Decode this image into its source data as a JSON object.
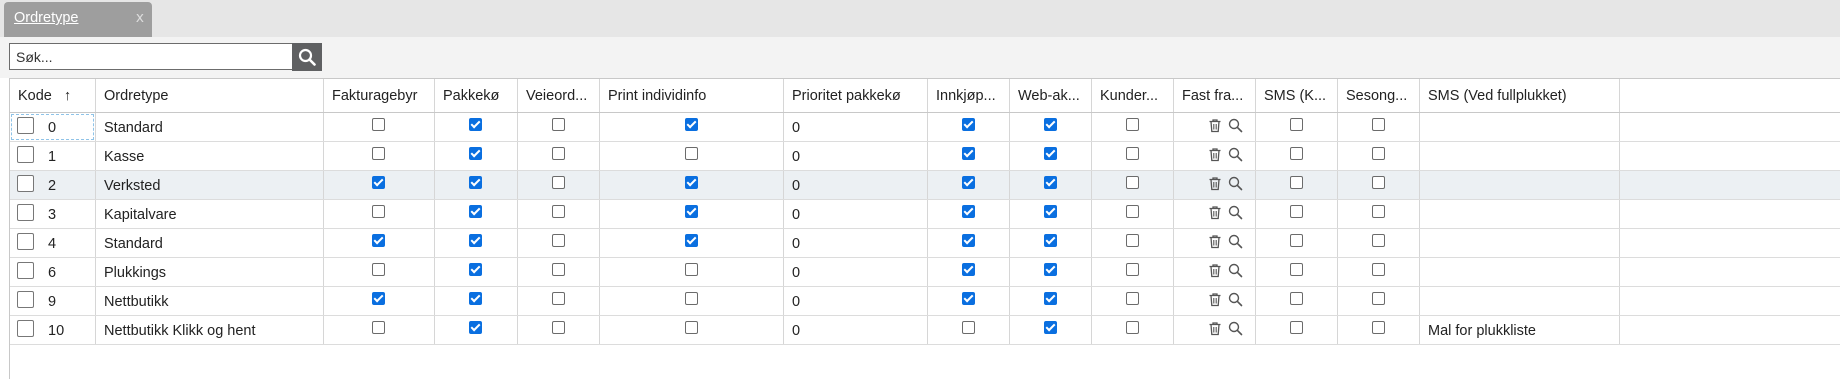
{
  "tab": {
    "label": "Ordretype",
    "close": "x"
  },
  "search": {
    "placeholder": "Søk..."
  },
  "columns": [
    {
      "key": "kode",
      "label": "Kode",
      "sort": "↑",
      "w": 86
    },
    {
      "key": "ordretype",
      "label": "Ordretype",
      "w": 228
    },
    {
      "key": "fakturagebyr",
      "label": "Fakturagebyr",
      "w": 111
    },
    {
      "key": "pakkeko",
      "label": "Pakkekø",
      "w": 83
    },
    {
      "key": "veieord",
      "label": "Veieord...",
      "w": 82
    },
    {
      "key": "print",
      "label": "Print individinfo",
      "w": 184
    },
    {
      "key": "prioritet",
      "label": "Prioritet pakkekø",
      "w": 144
    },
    {
      "key": "innkjop",
      "label": "Innkjøp...",
      "w": 82
    },
    {
      "key": "webak",
      "label": "Web-ak...",
      "w": 82
    },
    {
      "key": "kunder",
      "label": "Kunder...",
      "w": 82
    },
    {
      "key": "fastfra",
      "label": "Fast fra...",
      "w": 82
    },
    {
      "key": "smsk",
      "label": "SMS (K...",
      "w": 82
    },
    {
      "key": "sesong",
      "label": "Sesong...",
      "w": 82
    },
    {
      "key": "smsfull",
      "label": "SMS (Ved fullplukket)",
      "w": 200
    }
  ],
  "rows": [
    {
      "kode": "0",
      "ordretype": "Standard",
      "fakturagebyr": false,
      "pakkeko": true,
      "veieord": false,
      "print": true,
      "prioritet": "0",
      "innkjop": true,
      "webak": true,
      "kunder": false,
      "smsk": false,
      "sesong": false,
      "smsfull": ""
    },
    {
      "kode": "1",
      "ordretype": "Kasse",
      "fakturagebyr": false,
      "pakkeko": true,
      "veieord": false,
      "print": false,
      "prioritet": "0",
      "innkjop": true,
      "webak": true,
      "kunder": false,
      "smsk": false,
      "sesong": false,
      "smsfull": ""
    },
    {
      "kode": "2",
      "ordretype": "Verksted",
      "fakturagebyr": true,
      "pakkeko": true,
      "veieord": false,
      "print": true,
      "prioritet": "0",
      "innkjop": true,
      "webak": true,
      "kunder": false,
      "smsk": false,
      "sesong": false,
      "smsfull": ""
    },
    {
      "kode": "3",
      "ordretype": "Kapitalvare",
      "fakturagebyr": false,
      "pakkeko": true,
      "veieord": false,
      "print": true,
      "prioritet": "0",
      "innkjop": true,
      "webak": true,
      "kunder": false,
      "smsk": false,
      "sesong": false,
      "smsfull": ""
    },
    {
      "kode": "4",
      "ordretype": "Standard",
      "fakturagebyr": true,
      "pakkeko": true,
      "veieord": false,
      "print": true,
      "prioritet": "0",
      "innkjop": true,
      "webak": true,
      "kunder": false,
      "smsk": false,
      "sesong": false,
      "smsfull": ""
    },
    {
      "kode": "6",
      "ordretype": "Plukkings",
      "fakturagebyr": false,
      "pakkeko": true,
      "veieord": false,
      "print": false,
      "prioritet": "0",
      "innkjop": true,
      "webak": true,
      "kunder": false,
      "smsk": false,
      "sesong": false,
      "smsfull": ""
    },
    {
      "kode": "9",
      "ordretype": "Nettbutikk",
      "fakturagebyr": true,
      "pakkeko": true,
      "veieord": false,
      "print": false,
      "prioritet": "0",
      "innkjop": true,
      "webak": true,
      "kunder": false,
      "smsk": false,
      "sesong": false,
      "smsfull": ""
    },
    {
      "kode": "10",
      "ordretype": "Nettbutikk Klikk og hent",
      "fakturagebyr": false,
      "pakkeko": true,
      "veieord": false,
      "print": false,
      "prioritet": "0",
      "innkjop": false,
      "webak": true,
      "kunder": false,
      "smsk": false,
      "sesong": false,
      "smsfull": "Mal for plukkliste"
    }
  ],
  "icons": {
    "search_button": "search-icon",
    "row_delete": "trash-icon",
    "row_lookup": "magnifier-icon"
  },
  "colors": {
    "checked": "#0a6fe0",
    "tab_bg": "#9e9e9e",
    "search_btn": "#5f6062",
    "alt_row": "#ecf0f3"
  }
}
